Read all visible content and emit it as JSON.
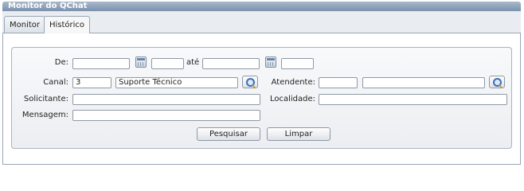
{
  "window": {
    "title": "Monitor do QChat"
  },
  "tabs": [
    {
      "label": "Monitor"
    },
    {
      "label": "Histórico"
    }
  ],
  "form": {
    "de_label": "De:",
    "ate_label": "até",
    "canal_label": "Canal:",
    "canal_code": "3",
    "canal_name": "Suporte Técnico",
    "atendente_label": "Atendente:",
    "solicitante_label": "Solicitante:",
    "localidade_label": "Localidade:",
    "mensagem_label": "Mensagem:"
  },
  "buttons": {
    "pesquisar": "Pesquisar",
    "limpar": "Limpar"
  }
}
